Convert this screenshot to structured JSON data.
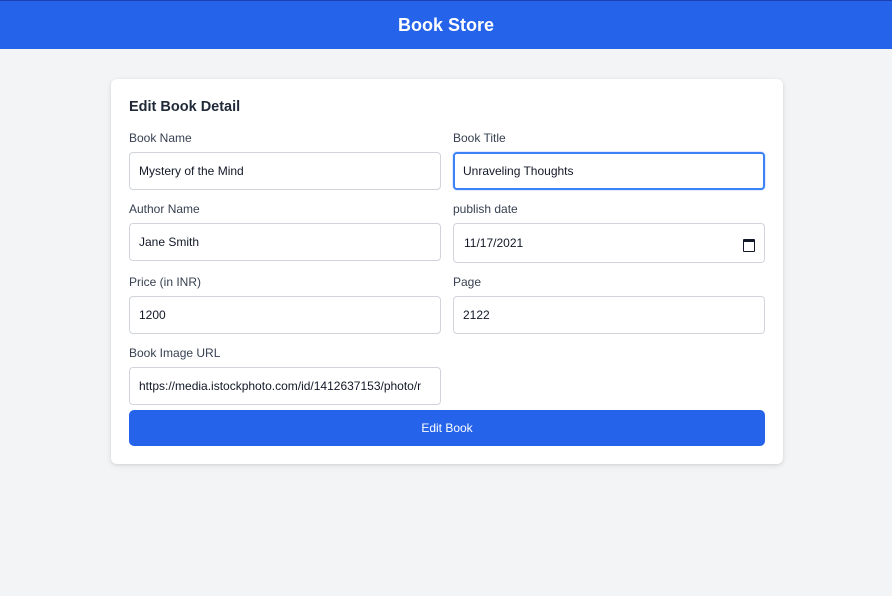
{
  "app": {
    "title": "Book Store"
  },
  "form": {
    "title": "Edit Book Detail",
    "book_name": {
      "label": "Book Name",
      "value": "Mystery of the Mind"
    },
    "book_title": {
      "label": "Book Title",
      "value": "Unraveling Thoughts"
    },
    "author_name": {
      "label": "Author Name",
      "value": "Jane Smith"
    },
    "publish_date": {
      "label": "publish date",
      "value": "11/17/2021"
    },
    "price": {
      "label": "Price (in INR)",
      "value": "1200"
    },
    "page": {
      "label": "Page",
      "value": "2122"
    },
    "image_url": {
      "label": "Book Image URL",
      "value": "https://media.istockphoto.com/id/1412637153/photo/r"
    },
    "submit_label": "Edit Book"
  },
  "colors": {
    "primary": "#2563eb",
    "background": "#f3f4f6",
    "focus": "#3b82f6"
  }
}
